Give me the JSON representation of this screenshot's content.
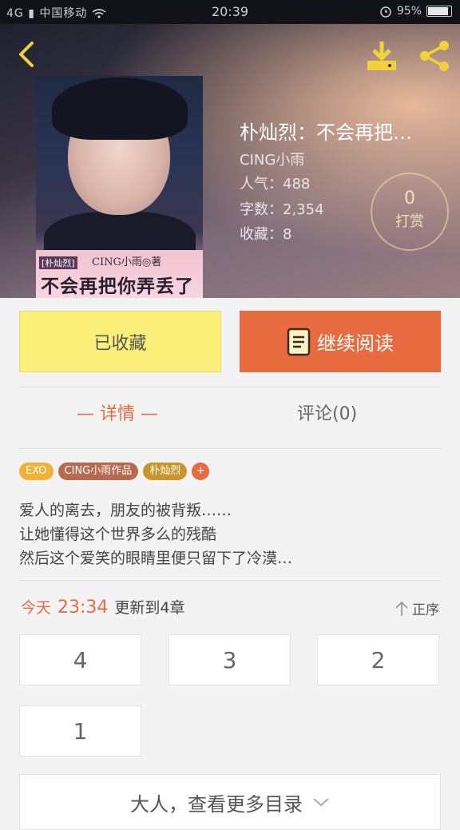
{
  "status_bar": {
    "carrier": "中国移动",
    "network": "4G",
    "time": "20:39",
    "battery": "95%"
  },
  "book": {
    "title": "朴灿烈：不会再把…",
    "author": "CING小雨",
    "popularity": "人气：488",
    "word_count": "字数：2,354",
    "favorites": "收藏：8",
    "cover": {
      "tag": "[朴灿烈]",
      "author": "CING小雨◎著",
      "title": "不会再把你弄丢了"
    }
  },
  "tip": {
    "count": "0",
    "label": "打赏"
  },
  "actions": {
    "favorited_label": "已收藏",
    "continue_label": "继续阅读"
  },
  "tabs": [
    {
      "label": "— 详情 —",
      "active": true
    },
    {
      "label": "评论(0)",
      "active": false
    }
  ],
  "tags": [
    {
      "label": "EXO",
      "color": "#f2b136"
    },
    {
      "label": "CING小雨作品",
      "color": "#b86a4e"
    },
    {
      "label": "朴灿烈",
      "color": "#c9962e"
    },
    {
      "label": "+",
      "color": "#e86a3f"
    }
  ],
  "synopsis": [
    "爱人的离去，朋友的被背叛……",
    "让她懂得这个世界多么的残酷",
    "然后这个爱笑的眼睛里便只留下了冷漠…"
  ],
  "update": {
    "day": "今天",
    "time": "23:34",
    "text": "更新到4章"
  },
  "sort_label": "正序",
  "chapters": [
    "4",
    "3",
    "2",
    "1"
  ],
  "more_label": "大人，查看更多目录",
  "colors": {
    "accent": "#e86a3f",
    "favorite_button": "#faf07a"
  },
  "icons": [
    "back-icon",
    "download-icon",
    "share-icon",
    "book-icon",
    "sort-up-arrow-icon",
    "chevron-down-icon"
  ]
}
